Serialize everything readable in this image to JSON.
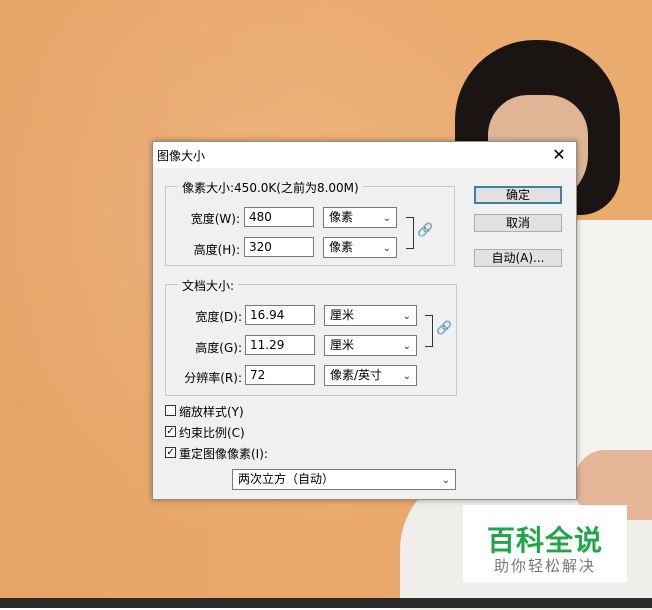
{
  "dialog": {
    "title": "图像大小",
    "close_glyph": "✕",
    "pixel_group": {
      "legend": "像素大小:450.0K(之前为8.00M)",
      "width_label": "宽度(W):",
      "width_value": "480",
      "width_unit": "像素",
      "height_label": "高度(H):",
      "height_value": "320",
      "height_unit": "像素"
    },
    "doc_group": {
      "legend": "文档大小:",
      "width_label": "宽度(D):",
      "width_value": "16.94",
      "width_unit": "厘米",
      "height_label": "高度(G):",
      "height_value": "11.29",
      "height_unit": "厘米",
      "res_label": "分辨率(R):",
      "res_value": "72",
      "res_unit": "像素/英寸"
    },
    "buttons": {
      "ok": "确定",
      "cancel": "取消",
      "auto": "自动(A)..."
    },
    "checkboxes": {
      "scale_styles": {
        "label": "缩放样式(Y)",
        "checked": false
      },
      "constrain": {
        "label": "约束比例(C)",
        "checked": true
      },
      "resample": {
        "label": "重定图像像素(I):",
        "checked": true
      }
    },
    "resample_method": "两次立方（自动）"
  },
  "icons": {
    "chevron": "chevron-down-icon",
    "link": "link-icon",
    "check": "✓"
  },
  "watermark": {
    "title": "百科全说",
    "subtitle": "助你轻松解决"
  },
  "colors": {
    "background": "#e8a86b",
    "watermark_green": "#20a648",
    "primary_border": "#3c7fb1"
  }
}
